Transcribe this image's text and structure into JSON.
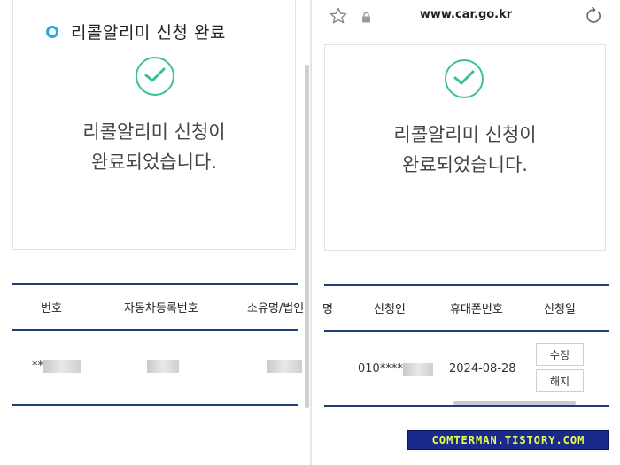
{
  "left": {
    "section_title": "리콜알리미 신청 완료",
    "message_line1": "리콜알리미 신청이",
    "message_line2": "완료되었습니다.",
    "table": {
      "headers": [
        "번호",
        "자동차등록번호",
        "소유명/법인"
      ],
      "row": {
        "number": "**"
      }
    }
  },
  "right": {
    "url": "www.car.go.kr",
    "message_line1": "리콜알리미 신청이",
    "message_line2": "완료되었습니다.",
    "table": {
      "headers": [
        "명",
        "신청인",
        "휴대폰번호",
        "신청일"
      ],
      "row": {
        "phone": "010****",
        "date": "2024-08-28"
      },
      "buttons": {
        "edit": "수정",
        "cancel": "해지"
      }
    }
  },
  "watermark": "COMTERMAN.TISTORY.COM",
  "colors": {
    "accent": "#3bbf9b",
    "bullet": "#29a8e0",
    "table_border": "#1f3f7a"
  }
}
